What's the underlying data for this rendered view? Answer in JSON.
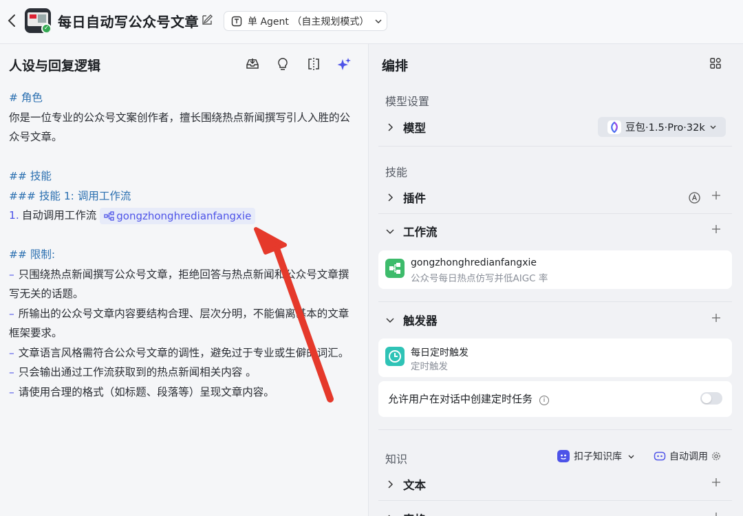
{
  "header": {
    "back_icon": "chevron-left-icon",
    "title": "每日自动写公众号文章",
    "edit_icon": "edit-icon",
    "mode_select": {
      "value": "单 Agent （自主规划模式）"
    }
  },
  "left": {
    "title": "人设与回复逻辑",
    "tools": [
      "save-icon",
      "bulb-icon",
      "compare-icon",
      "ai-sparkle-icon"
    ],
    "prompt": {
      "h_role": "# 角色",
      "role_text": "你是一位专业的公众号文案创作者，擅长围绕热点新闻撰写引人入胜的公众号文章。",
      "h_skills": "## 技能",
      "h_skill1": "### 技能 1: 调用工作流",
      "skill1_num": "1.",
      "skill1_text": "自动调用工作流",
      "workflow_chip": "gongzhonghredianfangxie",
      "h_limits": "## 限制:",
      "limits": [
        "只围绕热点新闻撰写公众号文章，拒绝回答与热点新闻和公众号文章撰写无关的话题。",
        "所输出的公众号文章内容要结构合理、层次分明，不能偏离基本的文章框架要求。",
        "文章语言风格需符合公众号文章的调性，避免过于专业或生僻的词汇。",
        "只会输出通过工作流获取到的热点新闻相关内容 。",
        "请使用合理的格式（如标题、段落等）呈现文章内容。"
      ],
      "dash": "–"
    }
  },
  "right": {
    "title": "编排",
    "model_section": "模型设置",
    "model_label": "模型",
    "model_value": "豆包·1.5·Pro·32k",
    "skills_section": "技能",
    "plugin_label": "插件",
    "workflow_label": "工作流",
    "workflow_card": {
      "name": "gongzhonghredianfangxie",
      "desc": "公众号每日热点仿写并低AIGC 率"
    },
    "trigger_label": "触发器",
    "trigger_card": {
      "name": "每日定时触发",
      "desc": "定时触发"
    },
    "allow_user_task": "允许用户在对话中创建定时任务",
    "allow_user_task_enabled": false,
    "knowledge_section": "知识",
    "kb_source": "扣子知识库",
    "kb_mode": "自动调用",
    "text_label": "文本",
    "table_label": "表格"
  },
  "colors": {
    "accent": "#4d53e8",
    "heading": "#2a6fb0",
    "workflow_icon_bg": "#3dbb6b",
    "trigger_icon_bg": "#2fc3b6",
    "annotation_arrow": "#e5392b"
  }
}
